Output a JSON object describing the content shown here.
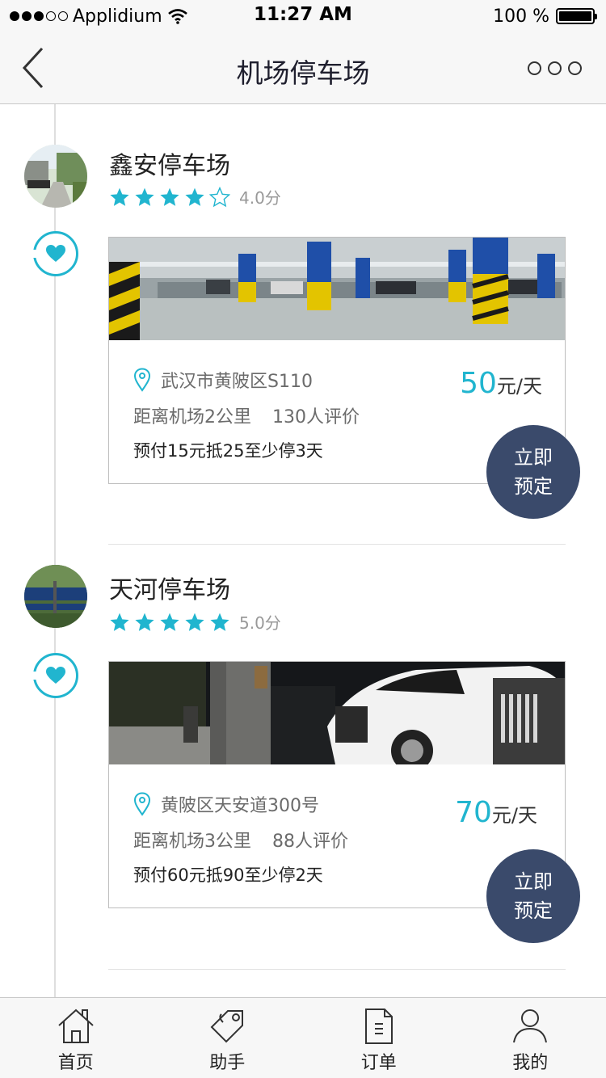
{
  "status_bar": {
    "carrier": "Applidium",
    "time": "11:27 AM",
    "battery": "100 %",
    "signal_dots_filled": 3,
    "signal_dots_total": 5
  },
  "nav": {
    "title": "机场停车场"
  },
  "lots": [
    {
      "name": "鑫安停车场",
      "rating": 4,
      "score": "4.0分",
      "address": "武汉市黄陂区S110",
      "distance": "距离机场2公里",
      "reviews": "130人评价",
      "promo": "预付15元抵25至少停3天",
      "price_num": "50",
      "price_unit": "元/天",
      "book_line1": "立即",
      "book_line2": "预定"
    },
    {
      "name": "天河停车场",
      "rating": 5,
      "score": "5.0分",
      "address": "黄陂区天安道300号",
      "distance": "距离机场3公里",
      "reviews": "88人评价",
      "promo": "预付60元抵90至少停2天",
      "price_num": "70",
      "price_unit": "元/天",
      "book_line1": "立即",
      "book_line2": "预定"
    }
  ],
  "tabs": [
    {
      "label": "首页",
      "icon": "home-icon"
    },
    {
      "label": "助手",
      "icon": "tag-icon"
    },
    {
      "label": "订单",
      "icon": "document-icon"
    },
    {
      "label": "我的",
      "icon": "user-icon"
    }
  ],
  "colors": {
    "accent": "#21b5cf",
    "book_button": "#3a4a6b"
  }
}
